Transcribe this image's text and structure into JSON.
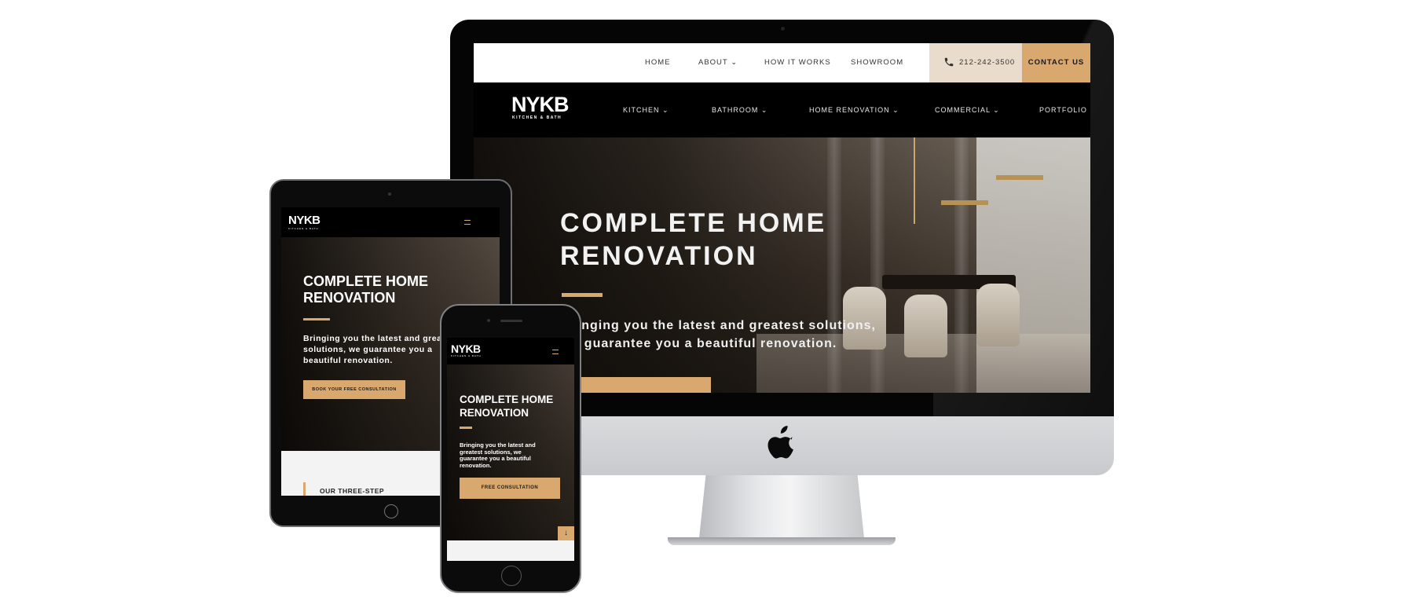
{
  "site": {
    "brand": "NYKB",
    "brand_sub": "KITCHEN & BATH"
  },
  "desktop": {
    "top_nav": [
      "HOME",
      "ABOUT",
      "HOW IT WORKS",
      "SHOWROOM"
    ],
    "phone": "212-242-3500",
    "contact_label": "CONTACT US",
    "main_nav": [
      "KITCHEN",
      "BATHROOM",
      "HOME RENOVATION",
      "COMMERCIAL",
      "PORTFOLIO"
    ],
    "hero_title_1": "COMPLETE HOME",
    "hero_title_2": "RENOVATION",
    "hero_sub_1": "Bringing you the latest and greatest solutions,",
    "hero_sub_2": "we guarantee you a beautiful renovation."
  },
  "tablet": {
    "hero_title_1": "COMPLETE HOME",
    "hero_title_2": "RENOVATION",
    "sub_1": "Bringing you the latest and greatest",
    "sub_2": "solutions, we guarantee you a",
    "sub_3": "beautiful renovation.",
    "cta": "BOOK YOUR FREE CONSULTATION",
    "lower_heading": "OUR THREE-STEP"
  },
  "phone": {
    "hero_title_1": "COMPLETE HOME",
    "hero_title_2": "RENOVATION",
    "sub_1": "Bringing you the latest and",
    "sub_2": "greatest solutions, we",
    "sub_3": "guarantee you a beautiful",
    "sub_4": "renovation.",
    "cta": "FREE CONSULTATION",
    "scroll_arrow": "↓"
  },
  "colors": {
    "accent": "#d9a86f",
    "phone_box": "#eadccc",
    "nav_dark": "#000000"
  },
  "icons": [
    "phone-icon",
    "chevron-down-icon",
    "hamburger-menu-icon",
    "arrow-down-icon",
    "apple-logo-icon"
  ]
}
